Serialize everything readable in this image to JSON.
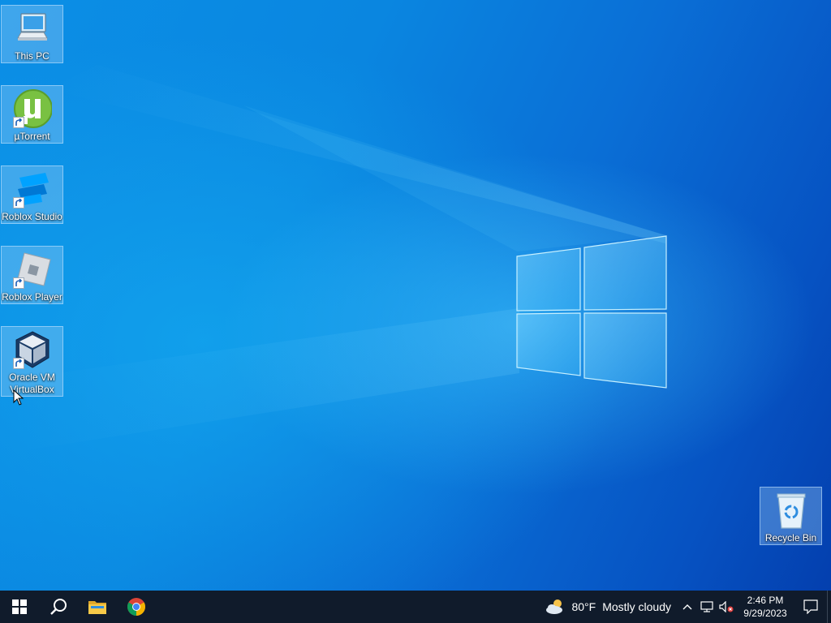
{
  "desktop": {
    "icons": [
      {
        "label": "This PC",
        "icon": "computer-icon",
        "shortcut": false
      },
      {
        "label": "µTorrent",
        "icon": "utorrent-icon",
        "shortcut": true
      },
      {
        "label": "Roblox Studio",
        "icon": "roblox-studio-icon",
        "shortcut": true
      },
      {
        "label": "Roblox Player",
        "icon": "roblox-player-icon",
        "shortcut": true
      },
      {
        "label": "Oracle VM VirtualBox",
        "icon": "virtualbox-icon",
        "shortcut": true
      }
    ],
    "recycle_bin": {
      "label": "Recycle Bin",
      "icon": "recycle-bin-icon"
    }
  },
  "taskbar": {
    "start": {
      "icon": "windows-start-icon"
    },
    "search": {
      "icon": "search-icon"
    },
    "pinned": [
      {
        "icon": "file-explorer-icon"
      },
      {
        "icon": "chrome-icon"
      }
    ],
    "weather": {
      "icon": "partly-cloudy-icon",
      "temperature": "80°F",
      "condition": "Mostly cloudy"
    },
    "tray_icons": [
      "chevron-up-icon",
      "network-icon",
      "volume-muted-icon"
    ],
    "clock": {
      "time": "2:46 PM",
      "date": "9/29/2023"
    },
    "notification_icon": "notification-icon"
  },
  "colors": {
    "taskbar_bg": "#101b2b",
    "wallpaper_blue": "#0a6fd6",
    "selection": "#a0d2f5"
  }
}
